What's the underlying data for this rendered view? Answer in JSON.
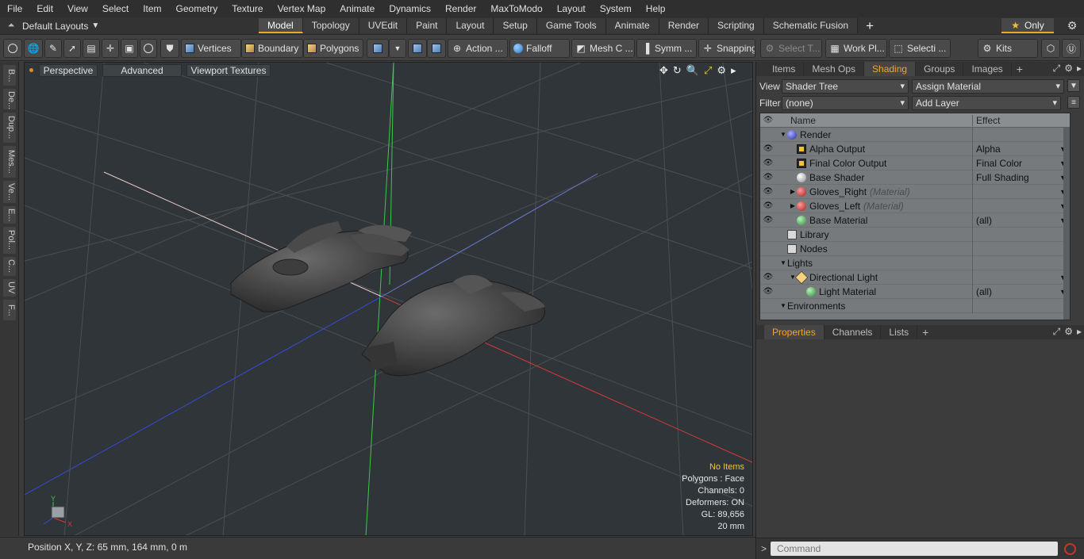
{
  "menu": [
    "File",
    "Edit",
    "View",
    "Select",
    "Item",
    "Geometry",
    "Texture",
    "Vertex Map",
    "Animate",
    "Dynamics",
    "Render",
    "MaxToModo",
    "Layout",
    "System",
    "Help"
  ],
  "layout_dropdown": "Default Layouts",
  "mode_tabs": [
    "Model",
    "Topology",
    "UVEdit",
    "Paint",
    "Layout",
    "Setup",
    "Game Tools",
    "Animate",
    "Render",
    "Scripting",
    "Schematic Fusion"
  ],
  "active_mode_tab": "Model",
  "only_label": "Only",
  "toolbar": {
    "vertices": "Vertices",
    "boundary": "Boundary",
    "polygons": "Polygons",
    "action": "Action ...",
    "falloff": "Falloff",
    "mesh": "Mesh C ...",
    "symm": "Symm ...",
    "snapping": "Snapping",
    "select_t": "Select T...",
    "work_pl": "Work Pl...",
    "selecti": "Selecti ...",
    "kits": "Kits"
  },
  "left_tabs": [
    "B...",
    "De...",
    "Dup...",
    "Mes...",
    "Ve...",
    "E...",
    "Pol...",
    "C...",
    "UV",
    "F..."
  ],
  "viewport": {
    "perspective": "Perspective",
    "advanced": "Advanced",
    "viewport_textures": "Viewport Textures",
    "info": {
      "no_items": "No Items",
      "polygons": "Polygons : Face",
      "channels": "Channels: 0",
      "deformers": "Deformers: ON",
      "gl": "GL: 89,656",
      "scale": "20 mm"
    },
    "axis_y": "Y",
    "axis_x": "X"
  },
  "status": "Position X, Y, Z:  65 mm, 164 mm, 0 m",
  "panel_tabs": [
    "Items",
    "Mesh Ops",
    "Shading",
    "Groups",
    "Images"
  ],
  "active_panel_tab": "Shading",
  "view_label": "View",
  "view_value": "Shader Tree",
  "assign_material": "Assign Material",
  "filter_label": "Filter",
  "filter_value": "(none)",
  "add_layer": "Add Layer",
  "tree_header": {
    "name": "Name",
    "effect": "Effect"
  },
  "tree": [
    {
      "name": "Render",
      "suffix": "",
      "effect": "",
      "eye": false,
      "expander": "▼",
      "icon": "sphere-blue",
      "indent": 0
    },
    {
      "name": "Alpha Output",
      "suffix": "",
      "effect": "Alpha",
      "eye": true,
      "expander": "",
      "icon": "image",
      "indent": 1
    },
    {
      "name": "Final Color Output",
      "suffix": "",
      "effect": "Final Color",
      "eye": true,
      "expander": "",
      "icon": "image",
      "indent": 1
    },
    {
      "name": "Base Shader",
      "suffix": "",
      "effect": "Full Shading",
      "eye": true,
      "expander": "",
      "icon": "sphere-white",
      "indent": 1
    },
    {
      "name": "Gloves_Right",
      "suffix": "(Material)",
      "effect": "",
      "eye": true,
      "expander": "▶",
      "icon": "sphere-red",
      "indent": 1
    },
    {
      "name": "Gloves_Left",
      "suffix": "(Material)",
      "effect": "",
      "eye": true,
      "expander": "▶",
      "icon": "sphere-red",
      "indent": 1
    },
    {
      "name": "Base Material",
      "suffix": "",
      "effect": "(all)",
      "eye": true,
      "expander": "",
      "icon": "sphere-green",
      "indent": 1
    },
    {
      "name": "Library",
      "suffix": "",
      "effect": "",
      "eye": false,
      "expander": "",
      "icon": "folder",
      "indent": 0
    },
    {
      "name": "Nodes",
      "suffix": "",
      "effect": "",
      "eye": false,
      "expander": "",
      "icon": "folder",
      "indent": 0
    },
    {
      "name": "Lights",
      "suffix": "",
      "effect": "",
      "eye": false,
      "expander": "▼",
      "icon": "none",
      "indent": 0
    },
    {
      "name": "Directional Light",
      "suffix": "",
      "effect": "",
      "eye": true,
      "expander": "▼",
      "icon": "light",
      "indent": 1
    },
    {
      "name": "Light Material",
      "suffix": "",
      "effect": "(all)",
      "eye": true,
      "expander": "",
      "icon": "sphere-green",
      "indent": 2
    },
    {
      "name": "Environments",
      "suffix": "",
      "effect": "",
      "eye": false,
      "expander": "▼",
      "icon": "none",
      "indent": 0
    }
  ],
  "lower_tabs": [
    "Properties",
    "Channels",
    "Lists"
  ],
  "active_lower_tab": "Properties",
  "command_placeholder": "Command",
  "colors": {
    "accent": "#f1a52a",
    "x_axis": "#d63a3a",
    "y_axis": "#3ac94a",
    "z_axis": "#3a4ad6"
  }
}
